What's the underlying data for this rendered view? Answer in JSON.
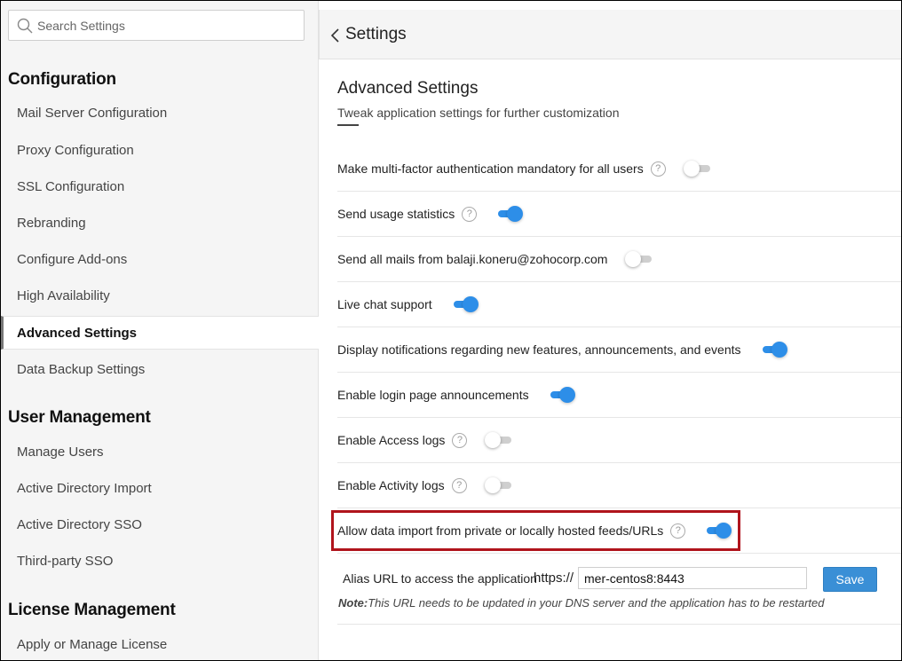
{
  "sidebar": {
    "search": {
      "placeholder": "Search Settings",
      "value": ""
    },
    "sections": [
      {
        "title": "Configuration",
        "items": [
          {
            "label": "Mail Server Configuration"
          },
          {
            "label": "Proxy Configuration"
          },
          {
            "label": "SSL Configuration"
          },
          {
            "label": "Rebranding"
          },
          {
            "label": "Configure Add-ons"
          },
          {
            "label": "High Availability"
          },
          {
            "label": "Advanced Settings",
            "active": true
          },
          {
            "label": "Data Backup Settings"
          }
        ]
      },
      {
        "title": "User Management",
        "items": [
          {
            "label": "Manage Users"
          },
          {
            "label": "Active Directory Import"
          },
          {
            "label": "Active Directory SSO"
          },
          {
            "label": "Third-party SSO"
          }
        ]
      },
      {
        "title": "License Management",
        "items": [
          {
            "label": "Apply or Manage License"
          }
        ]
      }
    ]
  },
  "header": {
    "title": "Settings",
    "back_icon": "chevron-left-icon"
  },
  "main": {
    "title": "Advanced Settings",
    "subtitle": "Tweak application settings for further customization",
    "settings": [
      {
        "label": "Make multi-factor authentication mandatory for all users",
        "help": true,
        "enabled": false
      },
      {
        "label": "Send usage statistics",
        "help": true,
        "enabled": true
      },
      {
        "label": "Send all mails from balaji.koneru@zohocorp.com",
        "help": false,
        "enabled": false
      },
      {
        "label": "Live chat support",
        "help": false,
        "enabled": true
      },
      {
        "label": "Display notifications regarding new features, announcements, and events",
        "help": false,
        "enabled": true
      },
      {
        "label": "Enable login page announcements",
        "help": false,
        "enabled": true
      },
      {
        "label": "Enable Access logs",
        "help": true,
        "enabled": false
      },
      {
        "label": "Enable Activity logs",
        "help": true,
        "enabled": false
      },
      {
        "label": "Allow data import from private or locally hosted feeds/URLs",
        "help": true,
        "enabled": true,
        "highlighted": true
      }
    ],
    "help_glyph": "?",
    "alias": {
      "label": "Alias URL to access the application",
      "prefix": "https://",
      "value": "mer-centos8:8443",
      "save_label": "Save",
      "note_prefix": "Note:",
      "note": "This URL needs to be updated in your DNS server and the application has to be restarted"
    }
  },
  "colors": {
    "accent": "#2d8ee8",
    "highlight": "#b0141c",
    "save_button": "#3a8fd6"
  }
}
